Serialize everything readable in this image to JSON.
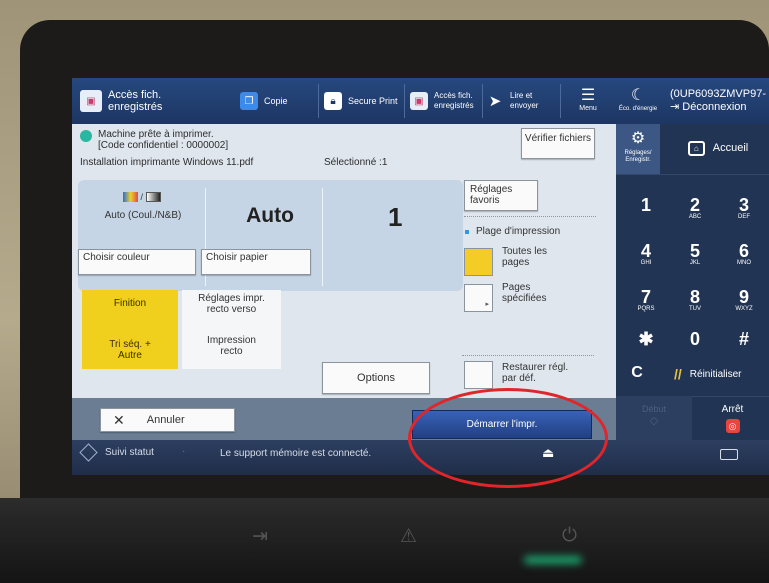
{
  "topbar": {
    "stored_files": "Accès fich. enregistrés",
    "copy": "Copie",
    "secure_print": "Secure Print",
    "stored_files_small": "Accès fich. enregistrés",
    "scan_send": "Lire et envoyer",
    "menu": "Menu",
    "energy_saver": "Éco. d'énergie",
    "user_id": "(0UP6093ZMVP97-",
    "logout": "Déconnexion"
  },
  "status": {
    "ready": "Machine prête à imprimer.",
    "pin": "[Code confidentiel : 0000002]",
    "filename": "Installation imprimante Windows 11.pdf",
    "selected": "Sélectionné :1"
  },
  "buttons": {
    "check_files": "Vérifier fichiers",
    "favorites": "Réglages favoris",
    "options": "Options",
    "cancel": "Annuler",
    "start_print": "Démarrer l'impr.",
    "restore": "Restaurer régl. par déf."
  },
  "settings": {
    "color_value": "Auto (Coul./N&B)",
    "choose_color": "Choisir couleur",
    "paper_value": "Auto",
    "choose_paper": "Choisir papier",
    "copies": "1",
    "finishing": "Finition",
    "finishing_value": "Tri séq. + Autre",
    "duplex_label": "Réglages impr. recto verso",
    "duplex_value": "Impression recto"
  },
  "print_range": {
    "title": "Plage d'impression",
    "all_pages": "Toutes les pages",
    "specified_pages": "Pages spécifiées"
  },
  "keypad": {
    "settings": "Réglages/ Enregistr.",
    "home": "Accueil",
    "keys": [
      {
        "n": "1",
        "s": ""
      },
      {
        "n": "2",
        "s": "ABC"
      },
      {
        "n": "3",
        "s": "DEF"
      },
      {
        "n": "4",
        "s": "GHI"
      },
      {
        "n": "5",
        "s": "JKL"
      },
      {
        "n": "6",
        "s": "MNO"
      },
      {
        "n": "7",
        "s": "PQRS"
      },
      {
        "n": "8",
        "s": "TUV"
      },
      {
        "n": "9",
        "s": "WXYZ"
      },
      {
        "n": "✱",
        "s": ""
      },
      {
        "n": "0",
        "s": ""
      },
      {
        "n": "#",
        "s": ""
      }
    ],
    "clear": "C",
    "reset": "Réinitialiser",
    "start": "Début",
    "stop": "Arrêt"
  },
  "statusbar": {
    "job_status": "Suivi statut",
    "message": "Le support mémoire est connecté."
  },
  "colors": {
    "topbar": "#26487f",
    "finishing": "#f0cf1d",
    "all_pages_swatch": "#f3cc25",
    "start_button": "#2c4f9c",
    "annotation": "#e0262b"
  }
}
